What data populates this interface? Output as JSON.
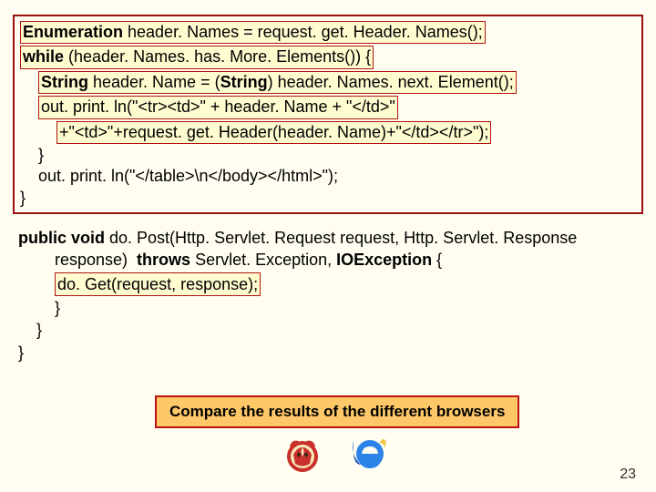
{
  "codebox": {
    "l1a": "Enumeration",
    "l1b": " header. Names = request. get. Header. Names();",
    "l2a": "while",
    "l2b": " (header. Names. has. More. Elements()) {",
    "l3a": "String",
    "l3b": " header. Name = (",
    "l3c": "String",
    "l3d": ") header. Names. next. Element();",
    "l4": "out. print. ln(\"<tr><td>\" + header. Name + \"</td>\"",
    "l5": "+\"<td>\"+request. get. Header(header. Name)+\"</td></tr>\");",
    "l6": "}",
    "l7": "out. print. ln(\"</table>\\n</body></html>\");",
    "l8": "}"
  },
  "method": {
    "l1a": "public void",
    "l1b": " do. Post(Http. Servlet. Request request, Http. Servlet. Response",
    "l2a": "response)  ",
    "l2b": "throws",
    "l2c": " Servlet. Exception, ",
    "l2d": "IOException",
    "l2e": " {",
    "l3": "do. Get(request, response);",
    "l4": "}",
    "l5": "}",
    "l6": "}"
  },
  "compare": "Compare the results of the different browsers",
  "slide_num": "23",
  "icons": {
    "moz": "mozilla-icon",
    "ie": "ie-icon"
  }
}
